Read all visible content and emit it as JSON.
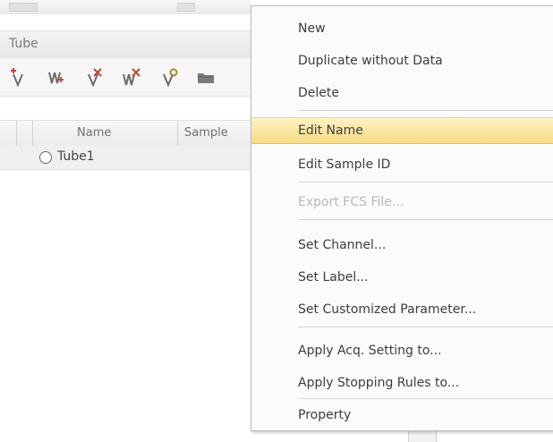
{
  "panel": {
    "title": "Tube",
    "toolbar": {
      "icons": [
        "add-tube-icon",
        "add-multiple-tubes-icon",
        "delete-tube-icon",
        "delete-multiple-tubes-icon",
        "tube-property-icon",
        "open-folder-icon"
      ]
    },
    "grid": {
      "headers": [
        "Name",
        "Sample"
      ],
      "rows": [
        {
          "name": "Tube1"
        }
      ]
    }
  },
  "context_menu": {
    "items": [
      {
        "label": "New"
      },
      {
        "label": "Duplicate without Data"
      },
      {
        "label": "Delete"
      },
      {
        "label": "Edit Name",
        "state": "highlighted"
      },
      {
        "label": "Edit Sample ID"
      },
      {
        "label": "Export FCS File...",
        "state": "disabled"
      },
      {
        "label": "Set Channel..."
      },
      {
        "label": "Set Label..."
      },
      {
        "label": "Set Customized Parameter..."
      },
      {
        "label": "Apply Acq. Setting to..."
      },
      {
        "label": "Apply Stopping Rules to..."
      },
      {
        "label": "Property"
      }
    ]
  },
  "colors": {
    "highlight_top": "#fff2c4",
    "highlight_bottom": "#f6dc85",
    "disabled_text": "#b8b8b8",
    "menu_background": "#fbfbfb"
  }
}
